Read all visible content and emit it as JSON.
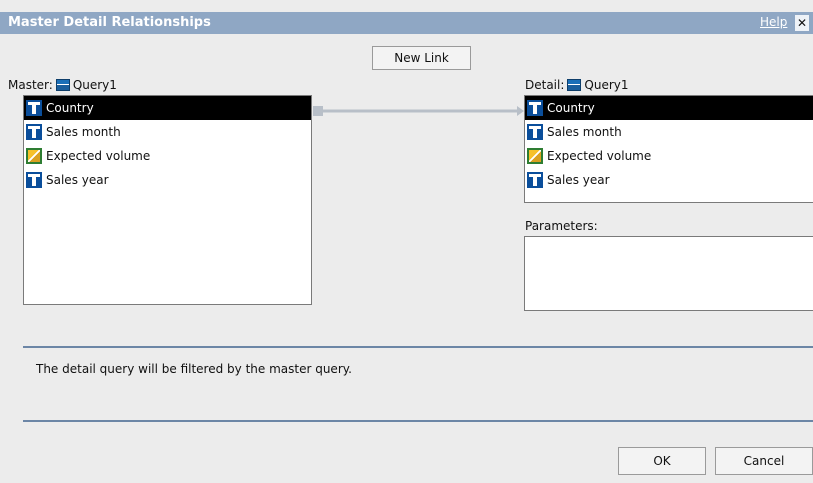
{
  "dialog": {
    "title": "Master Detail Relationships",
    "help_label": "Help",
    "close_label": "✕"
  },
  "toolbar": {
    "new_link_label": "New Link"
  },
  "master": {
    "label": "Master:",
    "query": "Query1",
    "items": [
      {
        "label": "Country",
        "icon": "dimension-icon",
        "selected": true
      },
      {
        "label": "Sales month",
        "icon": "dimension-icon",
        "selected": false
      },
      {
        "label": "Expected volume",
        "icon": "measure-icon",
        "selected": false
      },
      {
        "label": "Sales year",
        "icon": "dimension-icon",
        "selected": false
      }
    ]
  },
  "detail": {
    "label": "Detail:",
    "query": "Query1",
    "items": [
      {
        "label": "Country",
        "icon": "dimension-icon",
        "selected": true
      },
      {
        "label": "Sales month",
        "icon": "dimension-icon",
        "selected": false
      },
      {
        "label": "Expected volume",
        "icon": "measure-icon",
        "selected": false
      },
      {
        "label": "Sales year",
        "icon": "dimension-icon",
        "selected": false
      }
    ]
  },
  "parameters": {
    "label": "Parameters:"
  },
  "info": {
    "text": "The detail query will be filtered by the master query."
  },
  "footer": {
    "ok_label": "OK",
    "cancel_label": "Cancel"
  },
  "colors": {
    "titlebar": "#8fa7c4",
    "selection": "#000000",
    "separator": "#6c86a6",
    "connector": "#b8bfc8"
  }
}
